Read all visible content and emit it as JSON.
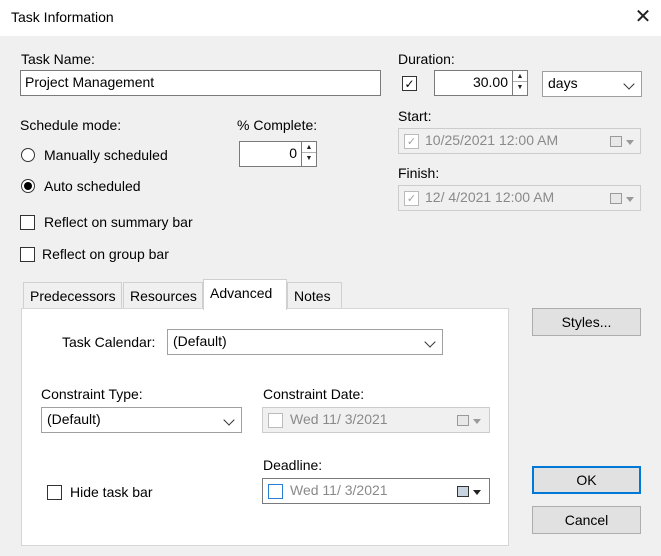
{
  "window": {
    "title": "Task Information"
  },
  "task_name": {
    "label": "Task Name:",
    "value": "Project Management"
  },
  "duration": {
    "label": "Duration:",
    "value": "30.00",
    "unit": "days"
  },
  "start": {
    "label": "Start:",
    "value": "10/25/2021 12:00 AM"
  },
  "finish": {
    "label": "Finish:",
    "value": "12/  4/2021 12:00 AM"
  },
  "schedule_mode": {
    "label": "Schedule mode:",
    "options": [
      "Manually scheduled",
      "Auto scheduled"
    ],
    "selected": "Auto scheduled"
  },
  "percent_complete": {
    "label": "% Complete:",
    "value": "0"
  },
  "reflect_summary": {
    "label": "Reflect on summary bar",
    "checked": false
  },
  "reflect_group": {
    "label": "Reflect on group bar",
    "checked": false
  },
  "tabs": [
    {
      "label": "Predecessors",
      "active": false
    },
    {
      "label": "Resources",
      "active": false
    },
    {
      "label": "Advanced",
      "active": true
    },
    {
      "label": "Notes",
      "active": false
    }
  ],
  "advanced": {
    "task_calendar": {
      "label": "Task Calendar:",
      "value": "(Default)"
    },
    "constraint_type": {
      "label": "Constraint Type:",
      "value": "(Default)"
    },
    "constraint_date": {
      "label": "Constraint Date:",
      "value": "Wed 11/  3/2021"
    },
    "deadline": {
      "label": "Deadline:",
      "value": "Wed 11/  3/2021"
    },
    "hide_task_bar": {
      "label": "Hide task bar",
      "checked": false
    }
  },
  "buttons": {
    "styles": "Styles...",
    "ok": "OK",
    "cancel": "Cancel"
  },
  "icons": {
    "close": "close-icon",
    "check": "checkmark-icon",
    "calendar": "calendar-icon",
    "dropdown": "chevron-down-icon",
    "spin_up": "spin-up-icon",
    "spin_down": "spin-down-icon"
  },
  "colors": {
    "accent": "#0078d7",
    "window_bg": "#f0f0f0",
    "title_bg": "#ffffff"
  }
}
